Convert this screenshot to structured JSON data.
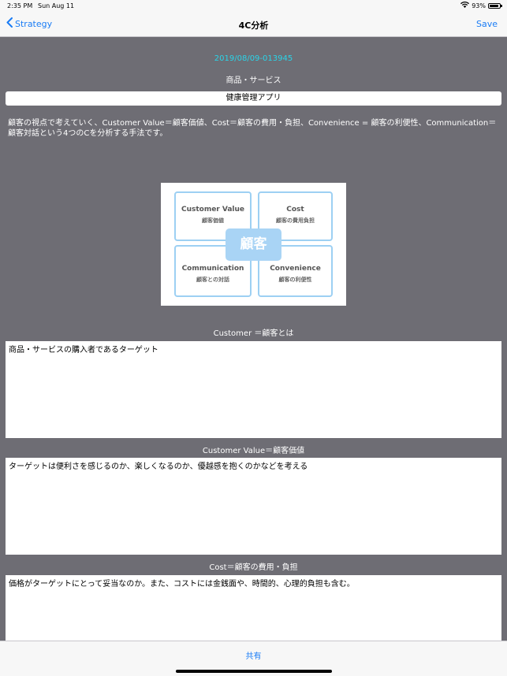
{
  "status_bar": {
    "time": "2:35 PM",
    "date": "Sun Aug 11",
    "battery": "93%",
    "battery_level": 0.93
  },
  "nav": {
    "back_label": "Strategy",
    "title": "4C分析",
    "save_label": "Save"
  },
  "doc_id": "2019/08/09-013945",
  "product": {
    "label": "商品・サービス",
    "value": "健康管理アプリ"
  },
  "description": "顧客の視点で考えていく、Customer Value＝顧客価値、Cost＝顧客の費用・負担、Convenience = 顧客の利便性、Communication＝顧客対話という4つのCを分析する手法です。",
  "diagram": {
    "center": "顧客",
    "boxes": [
      {
        "en": "Customer Value",
        "jp": "顧客価値"
      },
      {
        "en": "Cost",
        "jp": "顧客の費用負担"
      },
      {
        "en": "Communication",
        "jp": "顧客との対話"
      },
      {
        "en": "Convenience",
        "jp": "顧客の利便性"
      }
    ]
  },
  "sections": [
    {
      "label": "Customer ＝顧客とは",
      "text": "商品・サービスの購入者であるターゲット"
    },
    {
      "label": "Customer Value＝顧客価値",
      "text": "ターゲットは便利さを感じるのか、楽しくなるのか、優越感を抱くのかなどを考える"
    },
    {
      "label": "Cost＝顧客の費用・負担",
      "text": "価格がターゲットにとって妥当なのか。また、コストには金銭面や、時間的、心理的負担も含む。"
    }
  ],
  "toolbar": {
    "share_label": "共有"
  },
  "colors": {
    "accent": "#1a7cf5",
    "background": "#6e6d74",
    "doc_id": "#2ad4e8",
    "diagram_border": "#9dd0f3",
    "diagram_center": "#a9d4f5"
  }
}
